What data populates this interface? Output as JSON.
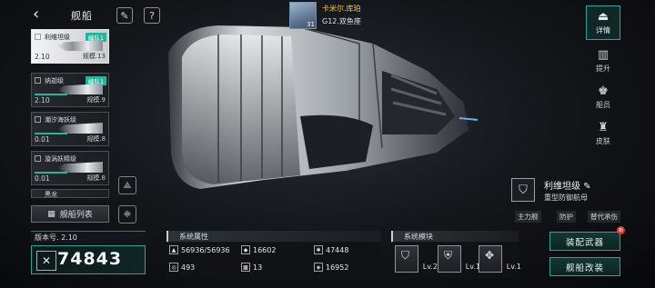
{
  "header": {
    "title": "舰船",
    "back_icon": "chevron-left-icon",
    "edit_icon": "pen-icon",
    "help_label": "?"
  },
  "player": {
    "name": "卡米尔.库珀",
    "tag": "G12.双鱼座",
    "level": "31"
  },
  "ship_list": [
    {
      "name": "利维坦级",
      "fleet": "编队1",
      "level": "2.10",
      "scale": "规模.13",
      "active": true
    },
    {
      "name": "纳迦级",
      "fleet": "编队1",
      "level": "2.10",
      "scale": "规模.9"
    },
    {
      "name": "潮汐海妖级",
      "fleet": "",
      "level": "0.01",
      "scale": "规模.8"
    },
    {
      "name": "漩涡妖精级",
      "fleet": "",
      "level": "0.01",
      "scale": "规模.8"
    },
    {
      "name": "黑龙",
      "fleet": "",
      "level": "",
      "scale": ""
    }
  ],
  "list_button": {
    "label": "舰船列表"
  },
  "version": {
    "label": "版本号. 2.10"
  },
  "power": {
    "value": "74843"
  },
  "attributes": {
    "title": "系统属性",
    "items": [
      "56936/56936",
      "16602",
      "47448",
      "493",
      "13",
      "16952"
    ]
  },
  "modules": {
    "title": "系统模块",
    "items": [
      {
        "label": "Lv.2"
      },
      {
        "label": "Lv.1"
      },
      {
        "label": "Lv.1"
      }
    ]
  },
  "right_nav": [
    {
      "label": "详情",
      "active": true
    },
    {
      "label": "提升"
    },
    {
      "label": "船员"
    },
    {
      "label": "皮肤"
    }
  ],
  "ship_info": {
    "name": "利维坦级",
    "class": "重型防御航母",
    "tags": [
      "主力舰",
      "防护",
      "替代承伤"
    ]
  },
  "actions": {
    "equip": "装配武器",
    "modify": "舰船改装",
    "new_badge": "新"
  }
}
